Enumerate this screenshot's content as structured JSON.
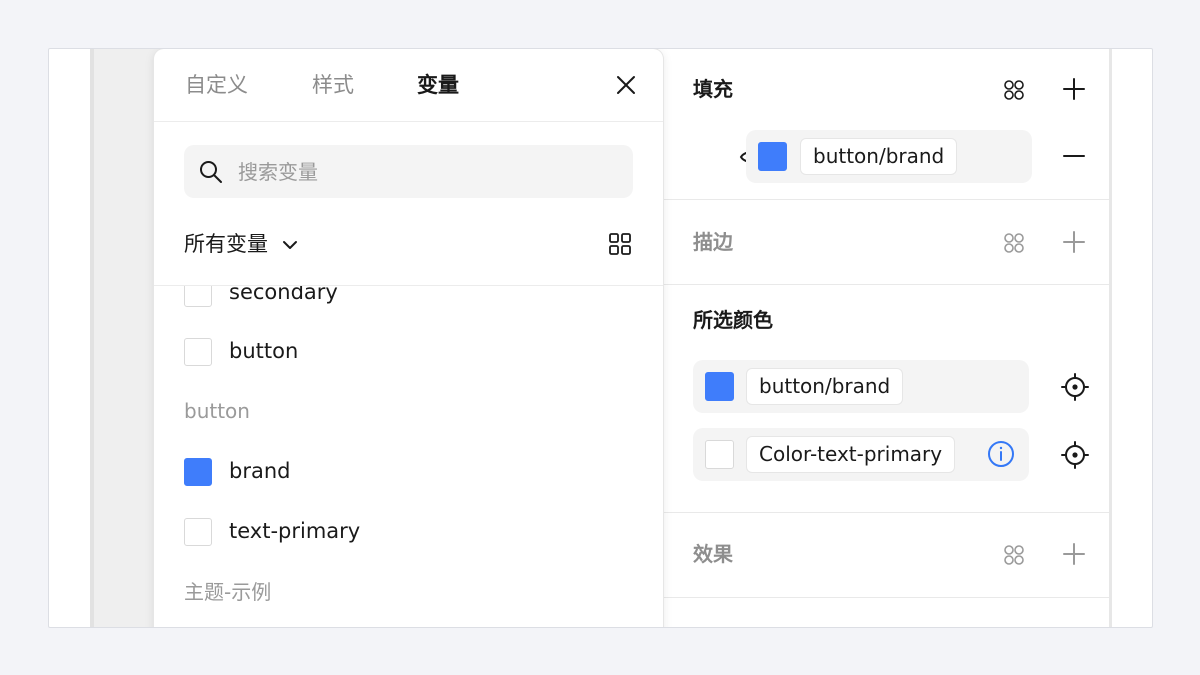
{
  "picker": {
    "tabs": [
      {
        "label": "自定义",
        "active": false
      },
      {
        "label": "样式",
        "active": false
      },
      {
        "label": "变量",
        "active": true
      }
    ],
    "search_placeholder": "搜索变量",
    "filter_label": "所有变量",
    "list": {
      "items_top": [
        {
          "label": "secondary",
          "swatch": "#ffffff"
        },
        {
          "label": "button",
          "swatch": "#ffffff"
        }
      ],
      "group_button": "button",
      "items_button": [
        {
          "label": "brand",
          "swatch": "#3f7dfb"
        },
        {
          "label": "text-primary",
          "swatch": "#ffffff"
        }
      ],
      "group_theme": "主题-示例"
    }
  },
  "panel": {
    "fill": {
      "title": "填充",
      "token": "button/brand",
      "swatch": "#3f7dfb"
    },
    "stroke": {
      "title": "描边"
    },
    "selected_colors": {
      "title": "所选颜色",
      "rows": [
        {
          "token": "button/brand",
          "swatch": "#3f7dfb"
        },
        {
          "token": "Color-text-primary",
          "swatch": "#ffffff"
        }
      ]
    },
    "effects": {
      "title": "效果"
    }
  },
  "colors": {
    "accent": "#3f7dfb",
    "info_icon": "#3478f6"
  }
}
